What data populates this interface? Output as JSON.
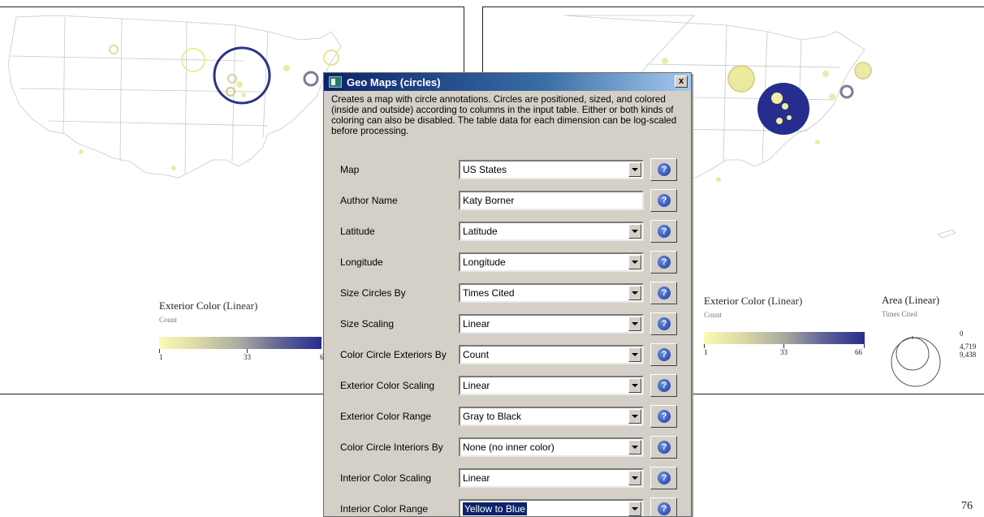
{
  "left_map": {
    "legend": {
      "title": "Exterior Color",
      "scale": "(Linear)",
      "subtitle": "Count",
      "ticks": [
        "1",
        "33",
        "6"
      ]
    }
  },
  "right_map": {
    "color_legend": {
      "title": "Exterior Color",
      "scale": "(Linear)",
      "subtitle": "Count",
      "ticks": [
        "1",
        "33",
        "66"
      ]
    },
    "area_legend": {
      "title": "Area",
      "scale": "(Linear)",
      "subtitle": "Times Cited",
      "values": [
        "0",
        "4,719",
        "9,438"
      ]
    }
  },
  "colors": {
    "ramp_low": "#fbfbb4",
    "ramp_high": "#262d8f",
    "dialog_bg": "#d4d0c8",
    "title_bar": "#0a246a"
  },
  "dialog": {
    "title": "Geo Maps (circles)",
    "close_label": "x",
    "description": "Creates a map with circle annotations.  Circles are positioned, sized, and colored (inside and outside) according to columns in the input table. Either or both kinds of coloring can also be disabled.  The table data for each dimension can be log-scaled before processing.",
    "help_icon": "?",
    "params": [
      {
        "label": "Map",
        "value": "US States",
        "type": "dropdown"
      },
      {
        "label": "Author Name",
        "value": "Katy Borner",
        "type": "text"
      },
      {
        "label": "Latitude",
        "value": "Latitude",
        "type": "dropdown"
      },
      {
        "label": "Longitude",
        "value": "Longitude",
        "type": "dropdown"
      },
      {
        "label": "Size Circles By",
        "value": "Times Cited",
        "type": "dropdown"
      },
      {
        "label": "Size Scaling",
        "value": "Linear",
        "type": "dropdown"
      },
      {
        "label": "Color Circle Exteriors By",
        "value": "Count",
        "type": "dropdown"
      },
      {
        "label": "Exterior Color Scaling",
        "value": "Linear",
        "type": "dropdown"
      },
      {
        "label": "Exterior Color Range",
        "value": "Gray to Black",
        "type": "dropdown"
      },
      {
        "label": "Color Circle Interiors By",
        "value": "None (no inner color)",
        "type": "dropdown"
      },
      {
        "label": "Interior Color Scaling",
        "value": "Linear",
        "type": "dropdown"
      },
      {
        "label": "Interior Color Range",
        "value": "Yellow to Blue",
        "type": "dropdown",
        "selected": true
      }
    ]
  },
  "page_number": "76"
}
